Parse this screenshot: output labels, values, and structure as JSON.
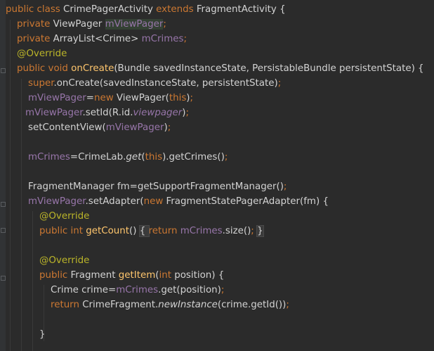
{
  "editor": {
    "lines": [
      {
        "tokens": [
          {
            "t": "public class ",
            "c": "kw"
          },
          {
            "t": "CrimePagerActivity ",
            "c": "dflt"
          },
          {
            "t": "extends ",
            "c": "kw"
          },
          {
            "t": "FragmentActivity {",
            "c": "dflt"
          }
        ]
      },
      {
        "tokens": [
          {
            "t": "private ",
            "c": "kw"
          },
          {
            "t": "ViewPager ",
            "c": "dflt"
          },
          {
            "t": "mViewPager",
            "c": "fld hl"
          },
          {
            "t": ";",
            "c": "kw"
          }
        ]
      },
      {
        "tokens": [
          {
            "t": "private ",
            "c": "kw"
          },
          {
            "t": "ArrayList<Crime> ",
            "c": "dflt"
          },
          {
            "t": "mCrimes",
            "c": "fld"
          },
          {
            "t": ";",
            "c": "kw"
          }
        ]
      },
      {
        "tokens": [
          {
            "t": "@Override",
            "c": "ann"
          }
        ]
      },
      {
        "tokens": [
          {
            "t": "public void ",
            "c": "kw"
          },
          {
            "t": "onCreate",
            "c": "mth"
          },
          {
            "t": "(Bundle savedInstanceState, PersistableBundle persistentState) {",
            "c": "dflt"
          }
        ]
      },
      {
        "tokens": [
          {
            "t": "super",
            "c": "kw"
          },
          {
            "t": ".onCreate(savedInstanceState, persistentState)",
            "c": "dflt"
          },
          {
            "t": ";",
            "c": "kw"
          }
        ]
      },
      {
        "tokens": [
          {
            "t": "mViewPager",
            "c": "fld"
          },
          {
            "t": "=",
            "c": "dflt"
          },
          {
            "t": "new ",
            "c": "kw"
          },
          {
            "t": "ViewPager(",
            "c": "dflt"
          },
          {
            "t": "this",
            "c": "kw"
          },
          {
            "t": ")",
            "c": "dflt"
          },
          {
            "t": ";",
            "c": "kw"
          }
        ]
      },
      {
        "tokens": [
          {
            "t": "mViewPager",
            "c": "fld"
          },
          {
            "t": ".setId(R.id.",
            "c": "dflt"
          },
          {
            "t": "viewpager",
            "c": "fld itl"
          },
          {
            "t": ")",
            "c": "dflt"
          },
          {
            "t": ";",
            "c": "kw"
          }
        ]
      },
      {
        "tokens": [
          {
            "t": "setContentView(",
            "c": "dflt"
          },
          {
            "t": "mViewPager",
            "c": "fld"
          },
          {
            "t": ")",
            "c": "dflt"
          },
          {
            "t": ";",
            "c": "kw"
          }
        ]
      },
      {
        "tokens": []
      },
      {
        "tokens": [
          {
            "t": "mCrimes",
            "c": "fld"
          },
          {
            "t": "=CrimeLab.",
            "c": "dflt"
          },
          {
            "t": "get",
            "c": "dflt itl"
          },
          {
            "t": "(",
            "c": "dflt"
          },
          {
            "t": "this",
            "c": "kw"
          },
          {
            "t": ").getCrimes()",
            "c": "dflt"
          },
          {
            "t": ";",
            "c": "kw"
          }
        ]
      },
      {
        "tokens": []
      },
      {
        "tokens": [
          {
            "t": "FragmentManager fm=getSupportFragmentManager()",
            "c": "dflt"
          },
          {
            "t": ";",
            "c": "kw"
          }
        ]
      },
      {
        "tokens": [
          {
            "t": "mViewPager",
            "c": "fld"
          },
          {
            "t": ".setAdapter(",
            "c": "dflt"
          },
          {
            "t": "new ",
            "c": "kw"
          },
          {
            "t": "FragmentStatePagerAdapter(fm) {",
            "c": "dflt"
          }
        ]
      },
      {
        "tokens": [
          {
            "t": "@Override",
            "c": "ann"
          }
        ]
      },
      {
        "tokens": [
          {
            "t": "public int ",
            "c": "kw"
          },
          {
            "t": "getCount",
            "c": "mth"
          },
          {
            "t": "() ",
            "c": "dflt"
          },
          {
            "t": "{ ",
            "c": "dflt brace-hl"
          },
          {
            "t": "return ",
            "c": "kw"
          },
          {
            "t": "mCrimes",
            "c": "fld"
          },
          {
            "t": ".size()",
            "c": "dflt"
          },
          {
            "t": "; ",
            "c": "kw"
          },
          {
            "t": "}",
            "c": "dflt brace-hl"
          }
        ]
      },
      {
        "tokens": []
      },
      {
        "tokens": [
          {
            "t": "@Override",
            "c": "ann"
          }
        ]
      },
      {
        "tokens": [
          {
            "t": "public ",
            "c": "kw"
          },
          {
            "t": "Fragment ",
            "c": "dflt"
          },
          {
            "t": "getItem",
            "c": "mth"
          },
          {
            "t": "(",
            "c": "dflt"
          },
          {
            "t": "int ",
            "c": "kw"
          },
          {
            "t": "position) {",
            "c": "dflt"
          }
        ]
      },
      {
        "tokens": [
          {
            "t": "Crime crime=",
            "c": "dflt"
          },
          {
            "t": "mCrimes",
            "c": "fld"
          },
          {
            "t": ".get(position)",
            "c": "dflt"
          },
          {
            "t": ";",
            "c": "kw"
          }
        ]
      },
      {
        "tokens": [
          {
            "t": "return ",
            "c": "kw"
          },
          {
            "t": "CrimeFragment.",
            "c": "dflt"
          },
          {
            "t": "newInstance",
            "c": "dflt itl"
          },
          {
            "t": "(crime.getId())",
            "c": "dflt"
          },
          {
            "t": ";",
            "c": "kw"
          }
        ]
      },
      {
        "tokens": []
      },
      {
        "tokens": [
          {
            "t": "}",
            "c": "dflt"
          }
        ]
      }
    ]
  }
}
